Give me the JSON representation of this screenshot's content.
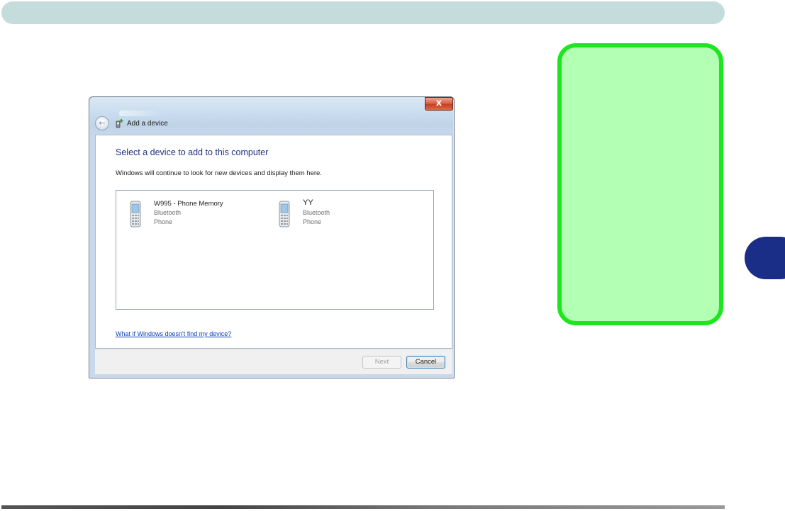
{
  "dialog": {
    "title": "Add a device",
    "close_glyph": "x",
    "back_glyph": "←",
    "heading": "Select a device to add to this computer",
    "subtext": "Windows will continue to look for new devices and display them here.",
    "devices": [
      {
        "name": "W995 - Phone Memory",
        "connection": "Bluetooth",
        "category": "Phone",
        "icon": "mobile-phone-icon"
      },
      {
        "name": "YY",
        "connection": "Bluetooth",
        "category": "Phone",
        "icon": "mobile-phone-icon"
      }
    ],
    "help_link": "What if Windows doesn't find my device?",
    "buttons": {
      "next": "Next",
      "cancel": "Cancel"
    }
  },
  "colors": {
    "header_bar": "#c5dcdc",
    "note_fill": "#b3ffb3",
    "note_border": "#1ee61e",
    "chapter_tab": "#1a2d87",
    "heading_text": "#1e3287",
    "link": "#0b3fb3"
  }
}
